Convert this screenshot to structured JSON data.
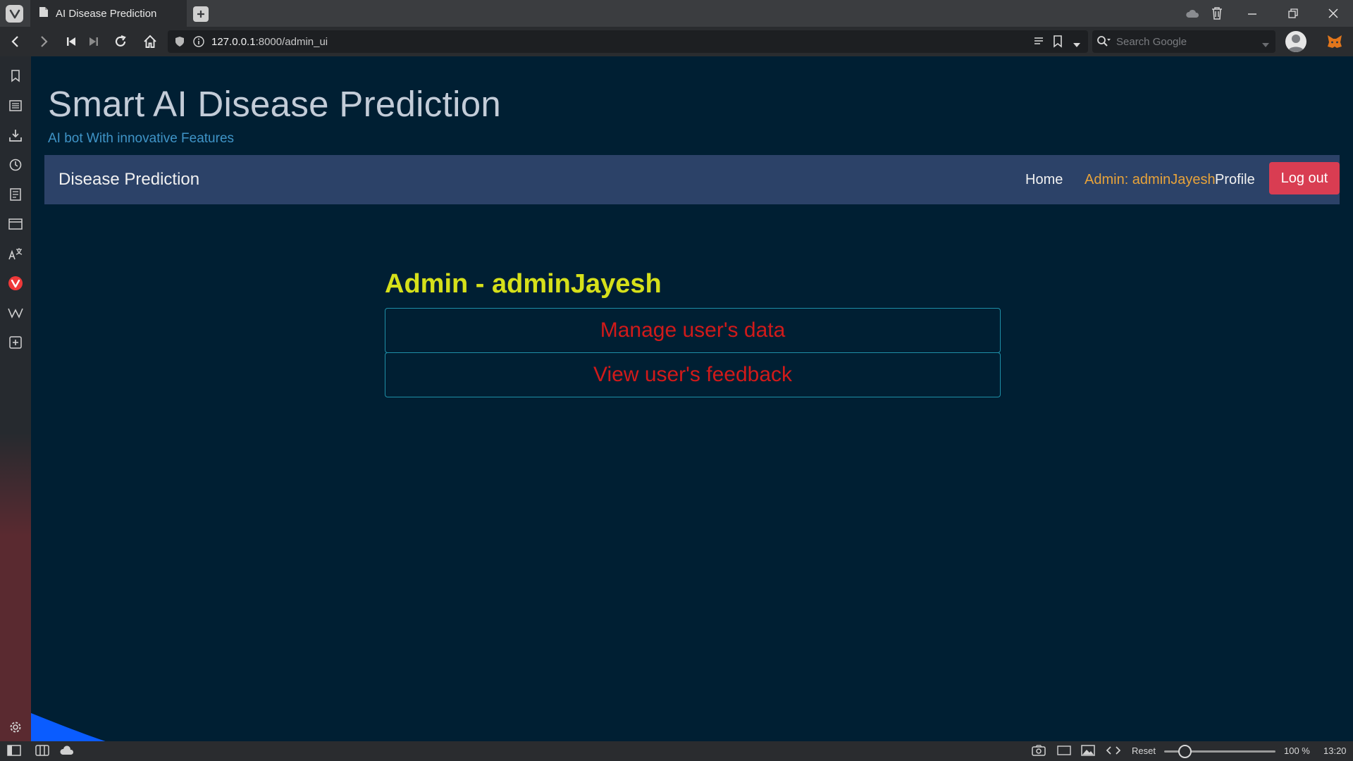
{
  "browser": {
    "tab_title": "AI Disease Prediction",
    "url_host": "127.0.0.1",
    "url_rest": ":8000/admin_ui",
    "search_placeholder": "Search Google"
  },
  "page": {
    "site_title": "Smart AI Disease Prediction",
    "site_subtitle": "AI bot With innovative Features",
    "navbar": {
      "brand": "Disease Prediction",
      "home": "Home",
      "admin": "Admin: adminJayesh",
      "profile": "Profile",
      "logout": "Log out"
    },
    "admin_heading": "Admin - adminJayesh",
    "actions": {
      "manage": "Manage user's data",
      "feedback": "View user's feedback"
    }
  },
  "statusbar": {
    "reset": "Reset",
    "zoom": "100 %",
    "time": "13:20"
  },
  "colors": {
    "page_bg": "#001f33",
    "navbar_bg": "#2c4268",
    "logout_bg": "#d93d52",
    "admin_heading": "#d6e01a",
    "action_text": "#d11a1a",
    "wave": "#0a5cff"
  }
}
